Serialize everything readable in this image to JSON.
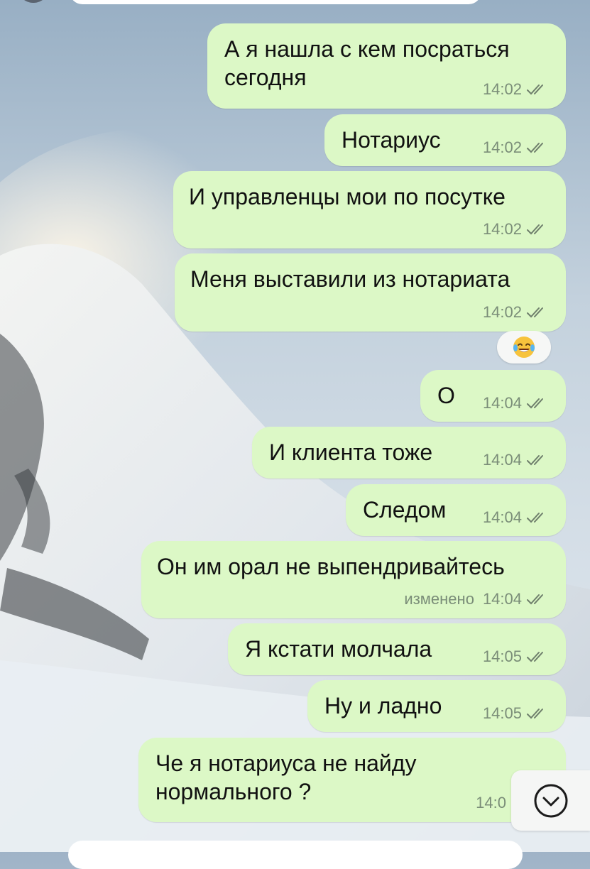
{
  "messages": [
    {
      "text": "А я нашла с кем посраться\nсегодня",
      "time": "14:02",
      "edited": ""
    },
    {
      "text": "Нотариус",
      "time": "14:02",
      "edited": ""
    },
    {
      "text": "И управленцы мои по посутке",
      "time": "14:02",
      "edited": ""
    },
    {
      "text": "Меня выставили из нотариата",
      "time": "14:02",
      "edited": ""
    },
    {
      "text": "О",
      "time": "14:04",
      "edited": ""
    },
    {
      "text": "И клиента тоже",
      "time": "14:04",
      "edited": ""
    },
    {
      "text": "Следом",
      "time": "14:04",
      "edited": ""
    },
    {
      "text": "Он им орал не выпендривайтесь",
      "time": "14:04",
      "edited": "изменено"
    },
    {
      "text": "Я кстати молчала",
      "time": "14:05",
      "edited": ""
    },
    {
      "text": "Ну и ладно",
      "time": "14:05",
      "edited": ""
    },
    {
      "text": "Че я нотариуса не найду\nнормального ?",
      "time": "14:0",
      "edited": ""
    }
  ],
  "reaction": {
    "emoji": "laughing-tears-emoji"
  },
  "scroll_button": {
    "icon": "chevron-down-circle-icon"
  },
  "colors": {
    "bubble_out": "#dcf8c6",
    "ticks": "#6f7f6c"
  }
}
